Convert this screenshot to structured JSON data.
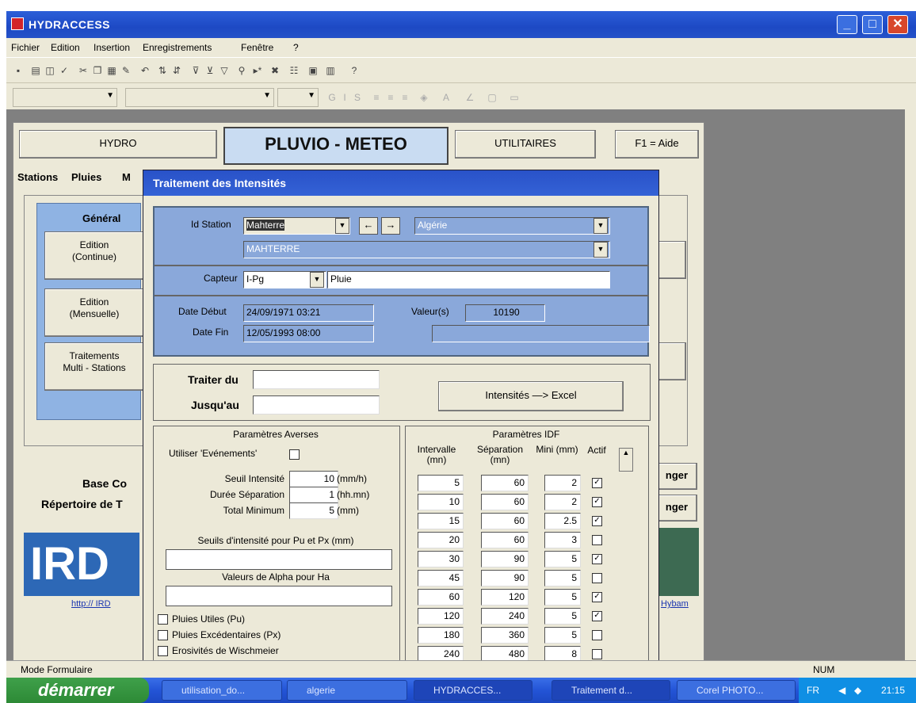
{
  "window": {
    "title": "HYDRACCESS"
  },
  "menu": [
    "Fichier",
    "Edition",
    "Insertion",
    "Enregistrements",
    "Fenêtre",
    "?"
  ],
  "nav": {
    "hydro": "HYDRO",
    "pluvio": "PLUVIO - METEO",
    "utilitaires": "UTILITAIRES",
    "aide": "F1 = Aide"
  },
  "tabs": [
    "Stations",
    "Pluies",
    "M"
  ],
  "side": {
    "general": "Général",
    "edition_continue": [
      "Edition",
      "(Continue)"
    ],
    "edition_mensuelle": [
      "Edition",
      "(Mensuelle)"
    ],
    "traitements": [
      "Traitements",
      "Multi - Stations"
    ],
    "base": "Base Co",
    "repertoire": "Répertoire de T",
    "link": "http:// IRD",
    "hybam_link": "Hybam",
    "changer1": "nger",
    "changer2": "nger",
    "ird_logo": "IRD"
  },
  "dialog": {
    "title": "Traitement des Intensités",
    "id_station_label": "Id Station",
    "id_station_value": "Mahterre",
    "country": "Algérie",
    "station_name": "MAHTERRE",
    "capteur_label": "Capteur",
    "capteur_value": "I-Pg",
    "capteur_type": "Pluie",
    "date_debut_label": "Date Début",
    "date_debut_value": "24/09/1971 03:21",
    "date_fin_label": "Date Fin",
    "date_fin_value": "12/05/1993 08:00",
    "valeurs_label": "Valeur(s)",
    "valeurs_value": "10190",
    "traiter_du": "Traiter du",
    "jusqu_au": "Jusqu'au",
    "excel_button": "Intensités —> Excel",
    "averses": {
      "title": "Paramètres Averses",
      "utiliser": "Utiliser 'Evénements'",
      "seuil_label": "Seuil Intensité",
      "seuil_value": "10",
      "seuil_unit": "(mm/h)",
      "duree_label": "Durée Séparation",
      "duree_value": "1",
      "duree_unit": "(hh.mn)",
      "total_label": "Total Minimum",
      "total_value": "5",
      "total_unit": "(mm)",
      "seuils_pu_px": "Seuils d'intensité pour Pu et Px (mm)",
      "alpha": "Valeurs de Alpha pour Ha",
      "pluies_utiles": "Pluies Utiles (Pu)",
      "pluies_exc": "Pluies Excédentaires (Px)",
      "erosivites": "Erosivités de Wischmeier"
    },
    "idf": {
      "title": "Paramètres IDF",
      "headers": [
        "Intervalle (mn)",
        "Séparation (mn)",
        "Mini (mm)",
        "Actif"
      ],
      "rows": [
        {
          "intervalle": "5",
          "separation": "60",
          "mini": "2",
          "actif": true
        },
        {
          "intervalle": "10",
          "separation": "60",
          "mini": "2",
          "actif": true
        },
        {
          "intervalle": "15",
          "separation": "60",
          "mini": "2.5",
          "actif": true
        },
        {
          "intervalle": "20",
          "separation": "60",
          "mini": "3",
          "actif": false
        },
        {
          "intervalle": "30",
          "separation": "90",
          "mini": "5",
          "actif": true
        },
        {
          "intervalle": "45",
          "separation": "90",
          "mini": "5",
          "actif": false
        },
        {
          "intervalle": "60",
          "separation": "120",
          "mini": "5",
          "actif": true
        },
        {
          "intervalle": "120",
          "separation": "240",
          "mini": "5",
          "actif": true
        },
        {
          "intervalle": "180",
          "separation": "360",
          "mini": "5",
          "actif": false
        },
        {
          "intervalle": "240",
          "separation": "480",
          "mini": "8",
          "actif": false
        }
      ]
    }
  },
  "status": {
    "mode": "Mode Formulaire",
    "num": "NUM"
  },
  "taskbar": {
    "start": "démarrer",
    "tasks": [
      "utilisation_do...",
      "algerie",
      "HYDRACCES...",
      "Traitement d...",
      "Corel PHOTO..."
    ],
    "lang": "FR",
    "time": "21:15"
  },
  "colors": {
    "titlebar": "#2355cc",
    "dialog_panel": "#8aa8da",
    "pluvio_bg": "#c9dcf2"
  }
}
